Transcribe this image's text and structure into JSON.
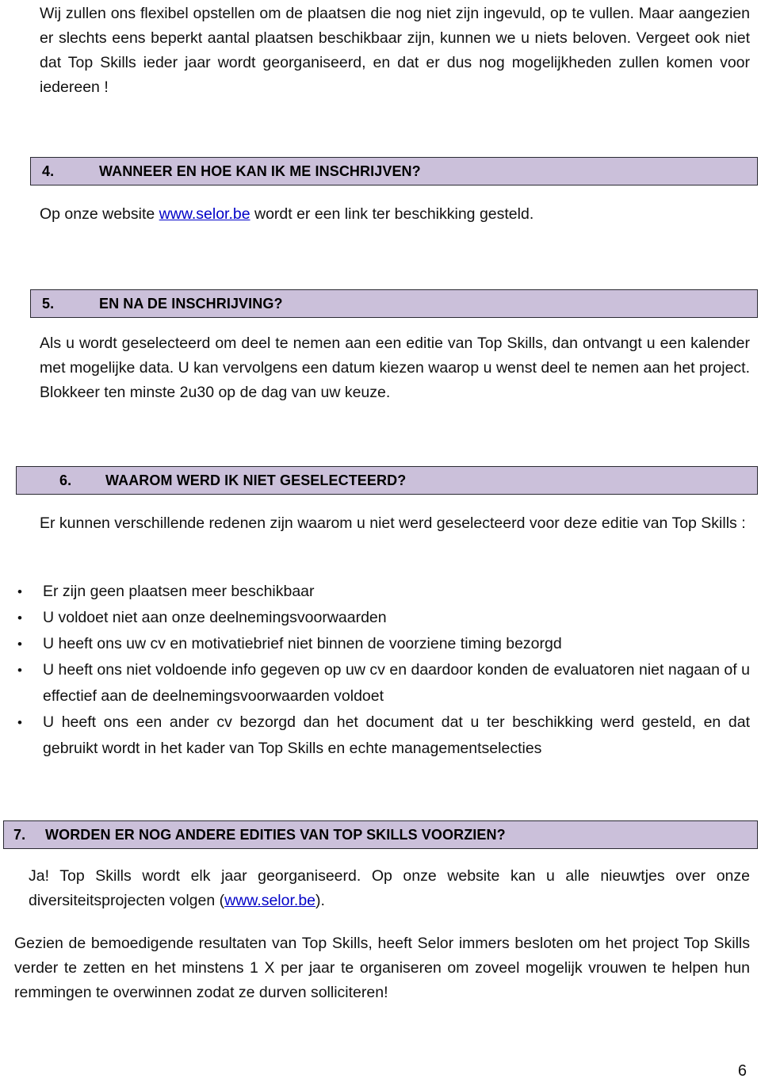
{
  "document": {
    "page_number": "6",
    "colors": {
      "heading_fill": "#cbc0da",
      "heading_border": "#2a2a32",
      "link": "#0000c8",
      "text": "#111111"
    }
  },
  "intro": {
    "paragraph": "Wij zullen ons flexibel opstellen om de plaatsen die nog niet zijn ingevuld, op te vullen. Maar aangezien er slechts eens beperkt aantal plaatsen beschikbaar zijn, kunnen we u niets beloven. Vergeet ook niet dat Top Skills ieder jaar wordt georganiseerd, en dat er dus nog mogelijkheden zullen komen voor iedereen !"
  },
  "sections": [
    {
      "number": "4.",
      "title": "WANNEER EN HOE KAN IK ME INSCHRIJVEN?",
      "body_before_link": "Op onze website ",
      "link_text": "www.selor.be",
      "body_after_link": " wordt er een link ter beschikking gesteld."
    },
    {
      "number": "5.",
      "title": "EN NA DE INSCHRIJVING?",
      "paragraph": "Als u wordt geselecteerd om deel te nemen aan een editie van Top Skills, dan ontvangt u een kalender met mogelijke data. U kan vervolgens een datum kiezen waarop u wenst deel te nemen aan het project. Blokkeer ten minste 2u30 op de dag van uw keuze."
    },
    {
      "number": "6.",
      "title": "WAAROM WERD IK NIET GESELECTEERD?",
      "paragraph": "Er kunnen verschillende redenen zijn waarom u niet werd geselecteerd voor deze editie van Top Skills :",
      "bullets": [
        "Er zijn geen plaatsen meer beschikbaar",
        "U voldoet niet aan onze deelnemingsvoorwaarden",
        "U heeft ons uw cv en motivatiebrief niet binnen de voorziene timing bezorgd",
        "U heeft ons niet voldoende info gegeven op uw cv en daardoor konden de evaluatoren niet nagaan of u effectief aan de deelnemingsvoorwaarden voldoet",
        "U heeft ons een ander cv bezorgd dan het document dat u ter beschikking werd gesteld, en dat gebruikt wordt in het kader van Top Skills en echte managementselecties"
      ]
    },
    {
      "number": "7.",
      "title": "WORDEN ER NOG ANDERE EDITIES VAN TOP SKILLS VOORZIEN?",
      "body_before_link": "Ja! Top Skills wordt elk jaar georganiseerd.  Op onze website kan u alle nieuwtjes over onze diversiteitsprojecten volgen (",
      "link_text": "www.selor.be",
      "body_after_link": ").",
      "closing_paragraph": "Gezien de bemoedigende resultaten van Top Skills, heeft Selor immers besloten om het project Top Skills verder te zetten en het minstens 1 X per jaar te organiseren om zoveel mogelijk vrouwen te helpen hun remmingen te overwinnen zodat ze durven solliciteren!"
    }
  ],
  "bullet_glyph": "•"
}
